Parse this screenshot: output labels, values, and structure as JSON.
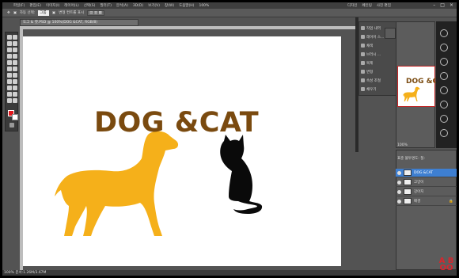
{
  "menu": [
    "파일(F)",
    "편집(E)",
    "이미지(I)",
    "레이어(L)",
    "선택(S)",
    "필터(T)",
    "분석(A)",
    "3D(D)",
    "보기(V)",
    "창(W)",
    "도움말(H)"
  ],
  "zoom": "100%",
  "right_menu": [
    "디자인",
    "페인팅",
    "사진 편집"
  ],
  "options": {
    "auto_select_label": "자동 선택:",
    "auto_select_value": "그룹",
    "show_transform_label": "변형 컨트롤 표시"
  },
  "document_tab": "도그 & 캣.PSD @ 100%(DOG &CAT, RGB/8)",
  "canvas": {
    "title": "DOG &CAT",
    "dog_color": "#f5b01a",
    "cat_color": "#0a0a0a",
    "title_color": "#7a4a0f"
  },
  "history": {
    "items": [
      "작업 내역",
      "레이어 스...",
      "채색",
      "브러시 ...",
      "복제",
      "변형",
      "속성 조절",
      "채우기"
    ]
  },
  "navigator": {
    "thumb_title": "DOG &CAT",
    "zoom": "100%"
  },
  "layers": {
    "header": [
      "표준",
      "불투명도:",
      "칠:"
    ],
    "rows": [
      "DOG &CAT",
      "고양이",
      "강아지",
      "배경"
    ]
  },
  "status": {
    "zoom": "100%",
    "doc": "문서:1.26M/3.67M"
  },
  "logo": [
    "A",
    "B",
    "OO"
  ],
  "icons": [
    "move-tool-icon",
    "marquee-tool-icon",
    "lasso-tool-icon",
    "crop-tool-icon",
    "brush-tool-icon",
    "eraser-tool-icon",
    "text-tool-icon",
    "zoom-tool-icon"
  ]
}
